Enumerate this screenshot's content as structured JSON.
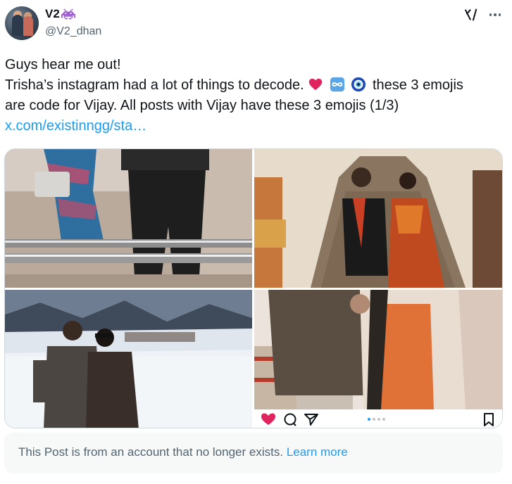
{
  "author": {
    "display_name": "V2",
    "badge_icon": "space-invader-icon",
    "handle": "@V2_dhan"
  },
  "header_actions": {
    "grok_icon": "grok-icon",
    "more_icon": "more-icon"
  },
  "tweet": {
    "line1": "Guys hear me out!",
    "line2_prefix": "Trisha’s instagram had a lot of things to decode.",
    "emojis": [
      "red-heart-emoji",
      "infinity-emoji",
      "nazar-amulet-emoji"
    ],
    "line2_suffix": "these 3 emojis",
    "line3": "are code for Vijay. All posts with Vijay have these 3 emojis (1/3)",
    "link": "x.com/existinngg/sta…"
  },
  "media": {
    "tiles": [
      {
        "description_icon": "elevator-photo"
      },
      {
        "description_icon": "temple-photo"
      },
      {
        "description_icon": "snow-photo"
      },
      {
        "description_icon": "walking-photo"
      }
    ],
    "instagram_bar": {
      "icons": [
        "heart-icon",
        "comment-icon",
        "share-icon",
        "bookmark-icon"
      ],
      "carousel_dots": 4,
      "active_dot": 1
    }
  },
  "notice": {
    "text": "This Post is from an account that no longer exists.",
    "link_label": "Learn more"
  },
  "colors": {
    "link": "#1d9bf0",
    "secondary_text": "#536471",
    "notice_bg": "#f7f9f9",
    "heart": "#e0245e"
  }
}
